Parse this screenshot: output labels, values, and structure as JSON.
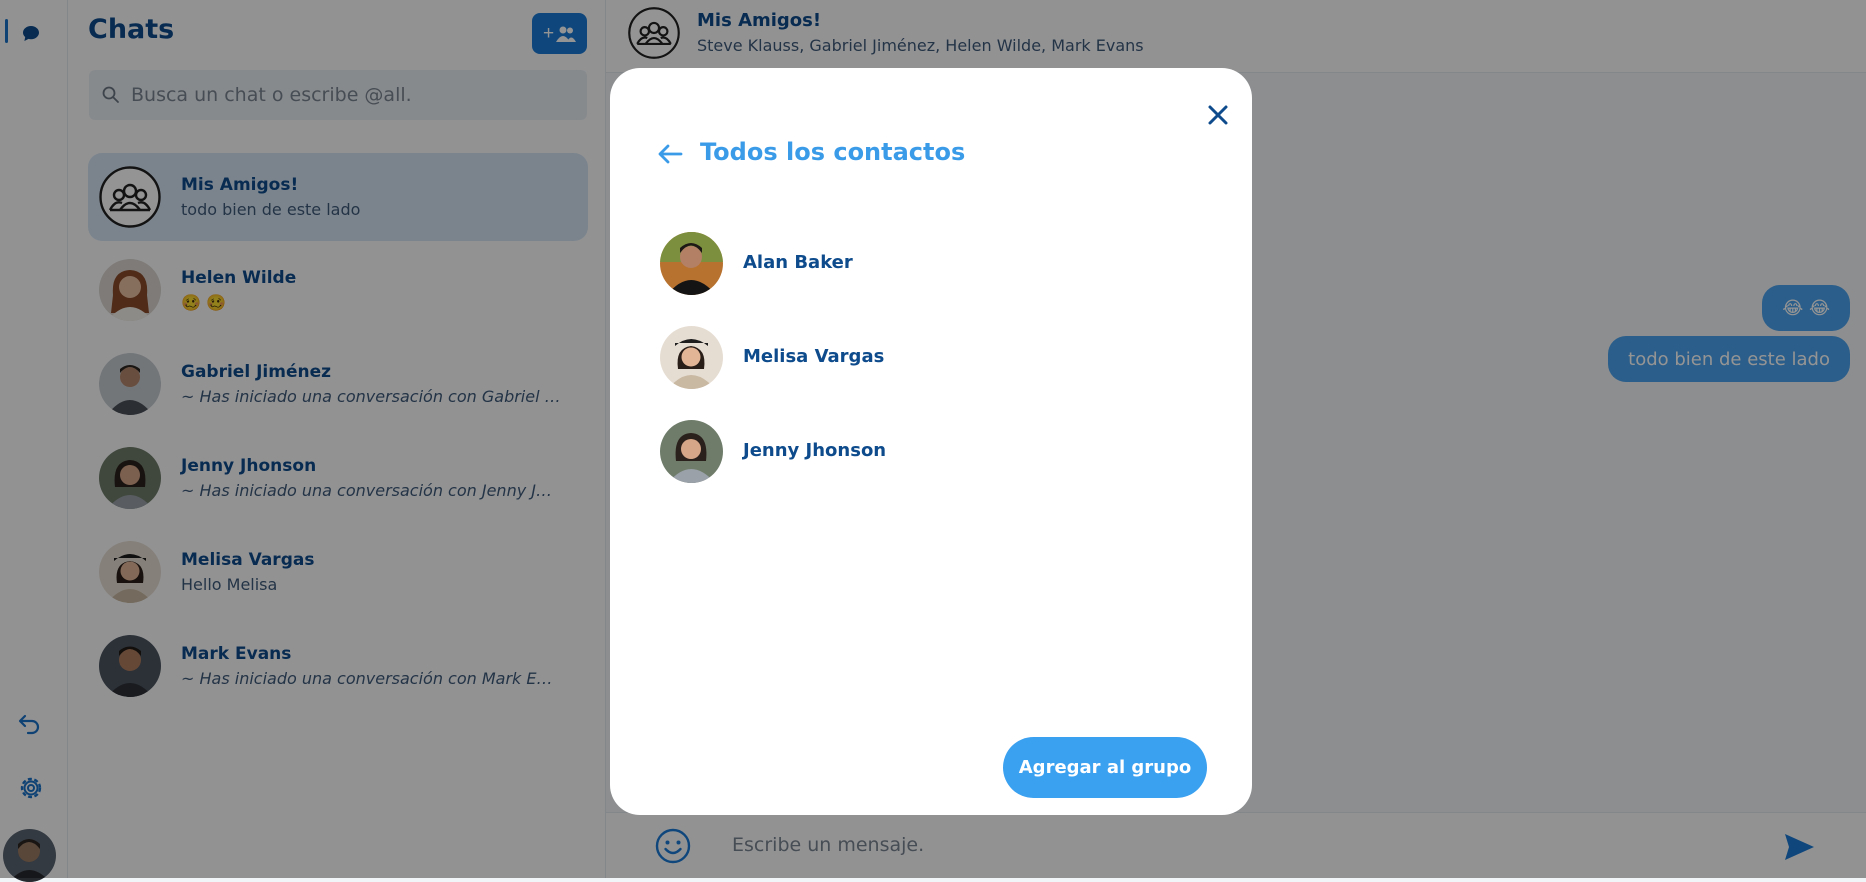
{
  "sidebar": {
    "title": "Chats",
    "new_chat_icon": "add-group-icon"
  },
  "search": {
    "placeholder": "Busca un chat o escribe @all."
  },
  "chats": [
    {
      "name": "Mis Amigos!",
      "preview": "todo bien de este lado",
      "selected": true,
      "avatar": "group-icon"
    },
    {
      "name": "Helen Wilde",
      "preview": "🥴 🥴",
      "avatar": "photo"
    },
    {
      "name": "Gabriel Jiménez",
      "preview": "~ Has iniciado una conversación con Gabriel Jimé...",
      "avatar": "photo"
    },
    {
      "name": "Jenny Jhonson",
      "preview": "~ Has iniciado una conversación con Jenny Jhonso...",
      "avatar": "photo"
    },
    {
      "name": "Melisa Vargas",
      "preview": "Hello Melisa",
      "avatar": "photo"
    },
    {
      "name": "Mark Evans",
      "preview": "~ Has iniciado una conversación con Mark Evans",
      "avatar": "photo"
    }
  ],
  "conversation": {
    "title": "Mis Amigos!",
    "members": "Steve Klauss, Gabriel Jiménez, Helen Wilde, Mark Evans",
    "messages": [
      {
        "text": "😂 😂"
      },
      {
        "text": "todo bien de este lado"
      }
    ],
    "composer_placeholder": "Escribe un mensaje."
  },
  "modal": {
    "title": "Todos los contactos",
    "contacts": [
      {
        "name": "Alan Baker"
      },
      {
        "name": "Melisa Vargas"
      },
      {
        "name": "Jenny Jhonson"
      }
    ],
    "add_button": "Agregar al grupo"
  },
  "colors": {
    "primary": "#1a7bd6",
    "accent": "#3aa0f0",
    "text": "#0d4b8c",
    "bubble": "#4aa3ee",
    "overlay": "rgba(0,0,0,0.42)"
  }
}
